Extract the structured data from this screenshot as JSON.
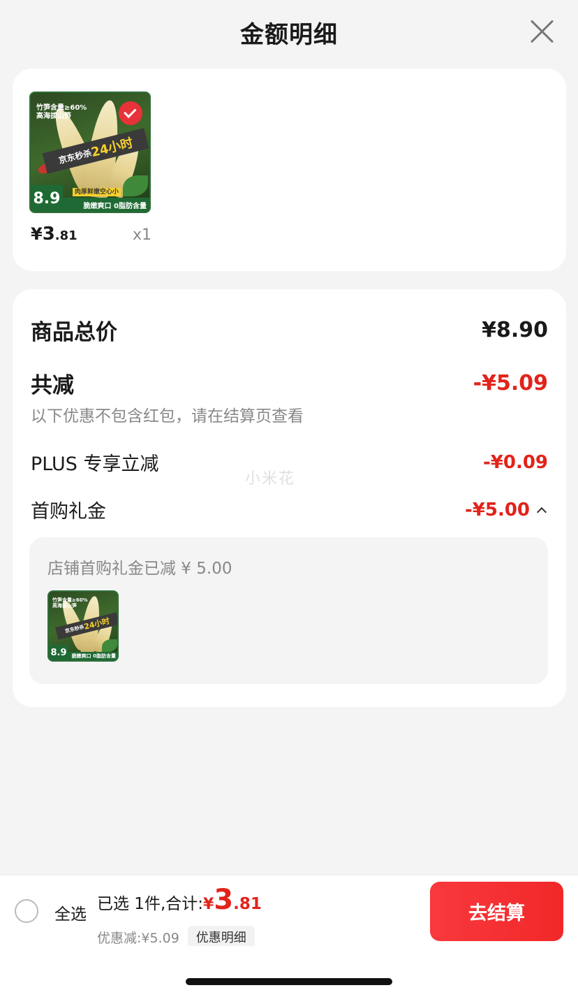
{
  "header": {
    "title": "金额明细"
  },
  "product": {
    "image_alt": "竹笋商品图",
    "image_text": {
      "headline_line1": "竹笋含量≥60%",
      "headline_line2": "高海拔山笋",
      "band_prefix": "京东秒杀",
      "band_highlight": "24小时",
      "price_tag": "8.9",
      "bottom_note": "肉厚鲜嫩空心小",
      "bottom_slogan": "脆嫩爽口 0脂肪含量"
    },
    "price_yen": "¥",
    "price_int": "3",
    "price_dec": ".81",
    "quantity": "x1"
  },
  "detail": {
    "total_label": "商品总价",
    "total_value": "¥8.90",
    "discount_label": "共减",
    "discount_value": "-¥5.09",
    "discount_note": "以下优惠不包含红包，请在结算页查看",
    "plus_label": "PLUS 专享立减",
    "plus_value": "-¥0.09",
    "first_gift_label": "首购礼金",
    "first_gift_value": "-¥5.00",
    "watermark": "小米花",
    "gift_box_text": "店铺首购礼金已减 ¥ 5.00"
  },
  "bottom": {
    "select_all": "全选",
    "selected_prefix": "已选 1件,合计:",
    "total_yen": "¥",
    "total_int": "3",
    "total_dec": ".81",
    "discount_line": "优惠减:¥5.09",
    "discount_detail": "优惠明细",
    "checkout": "去结算"
  },
  "colors": {
    "accent_red": "#e2231a",
    "background": "#f4f4f4"
  }
}
